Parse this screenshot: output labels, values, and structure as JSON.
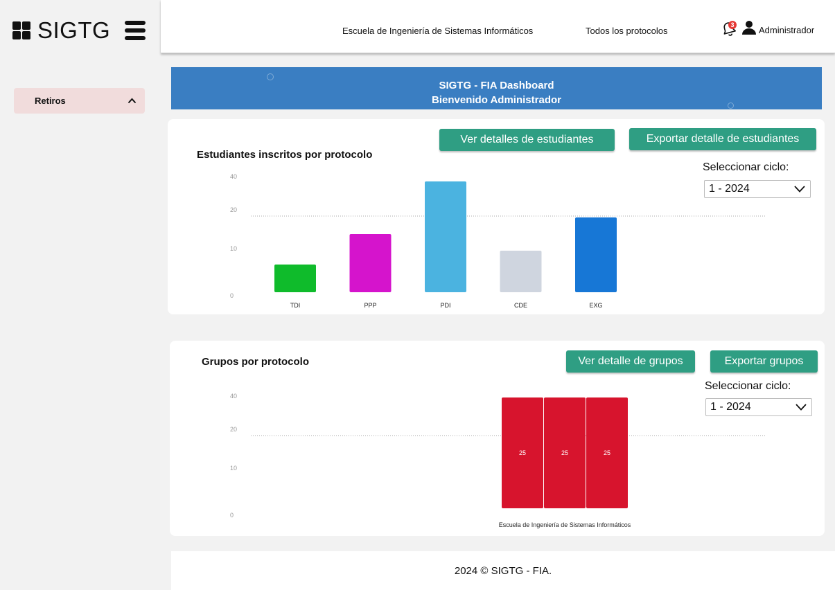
{
  "sidebar": {
    "brand": "SIGTG",
    "items": [
      {
        "label": "Retiros",
        "expanded": true
      }
    ]
  },
  "topbar": {
    "school_link": "Escuela de Ingeniería de Sistemas Informáticos",
    "protocols_link": "Todos los protocolos",
    "notification_count": "3",
    "user_label": "Administrador"
  },
  "banner": {
    "title": "SIGTG - FIA Dashboard",
    "subtitle": "Bienvenido Administrador"
  },
  "students_card": {
    "title": "Estudiantes inscritos por protocolo",
    "details_button": "Ver detalles de estudiantes",
    "export_button": "Exportar detalle de estudiantes",
    "cycle_label": "Seleccionar ciclo:",
    "cycle_value": "1 - 2024"
  },
  "groups_card": {
    "title": "Grupos por protocolo",
    "details_button": "Ver detalle de grupos",
    "export_button": "Exportar grupos",
    "cycle_label": "Seleccionar ciclo:",
    "cycle_value": "1 - 2024"
  },
  "chart_data": [
    {
      "type": "bar",
      "title": "Estudiantes inscritos por protocolo",
      "categories": [
        "TDI",
        "PPP",
        "PDI",
        "CDE",
        "EXG"
      ],
      "values": [
        10,
        21,
        40,
        15,
        27
      ],
      "colors": [
        "#0fbb2b",
        "#d514cc",
        "#4bb3e0",
        "#cfd5df",
        "#1777d6"
      ],
      "y_ticks": [
        "0",
        "10",
        "20",
        "40"
      ],
      "ylim": [
        0,
        40
      ],
      "grid": "dotted line at 20"
    },
    {
      "type": "bar",
      "title": "Grupos por protocolo",
      "categories": [
        "Escuela de Ingeniería de Sistemas Informáticos"
      ],
      "series": [
        {
          "values": [
            25
          ],
          "data_label": "25"
        },
        {
          "values": [
            25
          ],
          "data_label": "25"
        },
        {
          "values": [
            25
          ],
          "data_label": "25"
        }
      ],
      "color": "#d7142d",
      "y_ticks": [
        "0",
        "10",
        "20",
        "40"
      ],
      "ylim": [
        0,
        40
      ],
      "grid": "dotted line at 20"
    }
  ],
  "footer": {
    "text": "2024 © SIGTG - FIA."
  },
  "colors": {
    "accent": "#2f9e83",
    "banner": "#3a7ec2",
    "sidebar_item_bg": "#f1dcdc"
  }
}
